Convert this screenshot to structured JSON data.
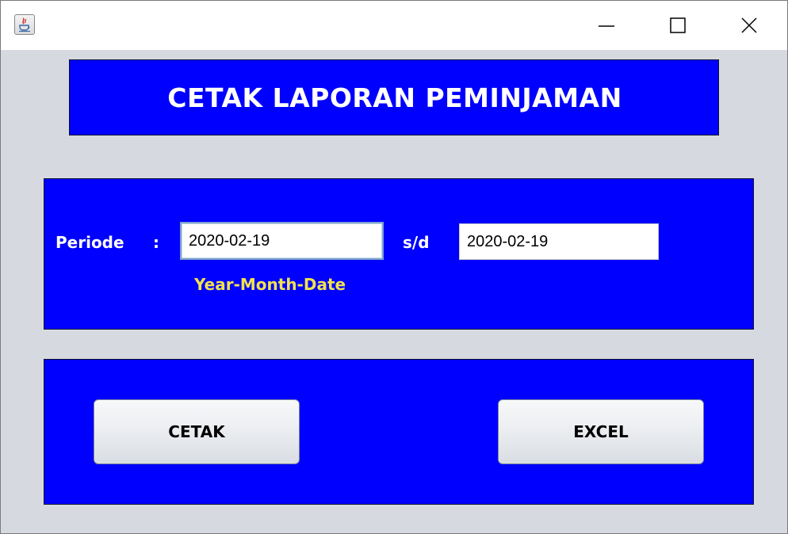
{
  "window": {
    "title_icon": "java-app-icon",
    "controls": {
      "minimize_icon": "minimize-icon",
      "maximize_icon": "maximize-icon",
      "close_icon": "close-icon"
    }
  },
  "header": {
    "title": "CETAK LAPORAN PEMINJAMAN"
  },
  "period": {
    "label": "Periode",
    "colon": ":",
    "from_value": "2020-02-19",
    "separator": "s/d",
    "to_value": "2020-02-19",
    "format_hint": "Year-Month-Date"
  },
  "actions": {
    "print_label": "CETAK",
    "excel_label": "EXCEL"
  },
  "colors": {
    "panel_bg": "#0000ff",
    "window_bg": "#d6d9df",
    "hint_text": "#f0e34c",
    "label_text": "#ffffff"
  }
}
